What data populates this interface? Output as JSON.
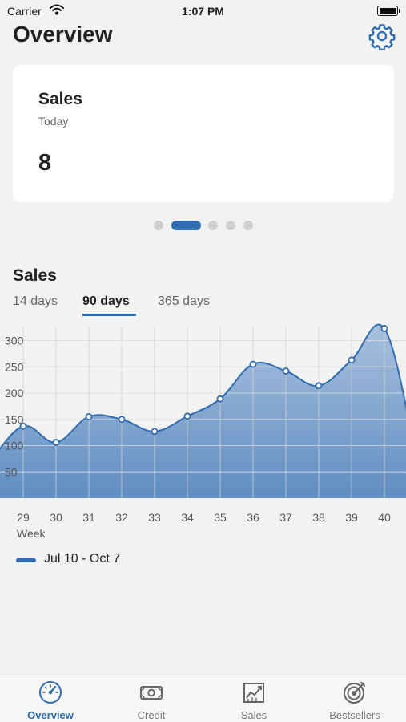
{
  "status_bar": {
    "carrier": "Carrier",
    "time": "1:07 PM"
  },
  "header": {
    "title": "Overview",
    "settings_icon": "gear-icon"
  },
  "summary_card": {
    "title": "Sales",
    "subtitle": "Today",
    "value": "8"
  },
  "pager": {
    "count": 5,
    "active_index": 1
  },
  "sales_section": {
    "title": "Sales",
    "range_tabs": [
      {
        "label": "14 days",
        "active": false
      },
      {
        "label": "90 days",
        "active": true
      },
      {
        "label": "365 days",
        "active": false
      }
    ]
  },
  "chart_data": {
    "type": "area",
    "xlabel": "Week",
    "ylabel": "",
    "x": [
      29,
      30,
      31,
      32,
      33,
      34,
      35,
      36,
      37,
      38,
      39,
      40
    ],
    "series": [
      {
        "name": "Jul 10 - Oct 7",
        "values": [
          137,
          106,
          155,
          150,
          127,
          156,
          189,
          255,
          242,
          214,
          263,
          323
        ],
        "color": "#2f6cb0"
      }
    ],
    "yticks": [
      50,
      100,
      150,
      200,
      250,
      300
    ],
    "grid": true,
    "legend_position": "bottom-left"
  },
  "tab_bar": {
    "items": [
      {
        "label": "Overview",
        "icon": "speedometer-icon",
        "active": true
      },
      {
        "label": "Credit",
        "icon": "cash-icon",
        "active": false
      },
      {
        "label": "Sales",
        "icon": "sales-chart-icon",
        "active": false
      },
      {
        "label": "Bestsellers",
        "icon": "target-icon",
        "active": false
      }
    ]
  },
  "colors": {
    "accent": "#2f6cb0",
    "area_fill": "#8fb0d6",
    "background": "#f2f2f2",
    "card": "#ffffff"
  }
}
